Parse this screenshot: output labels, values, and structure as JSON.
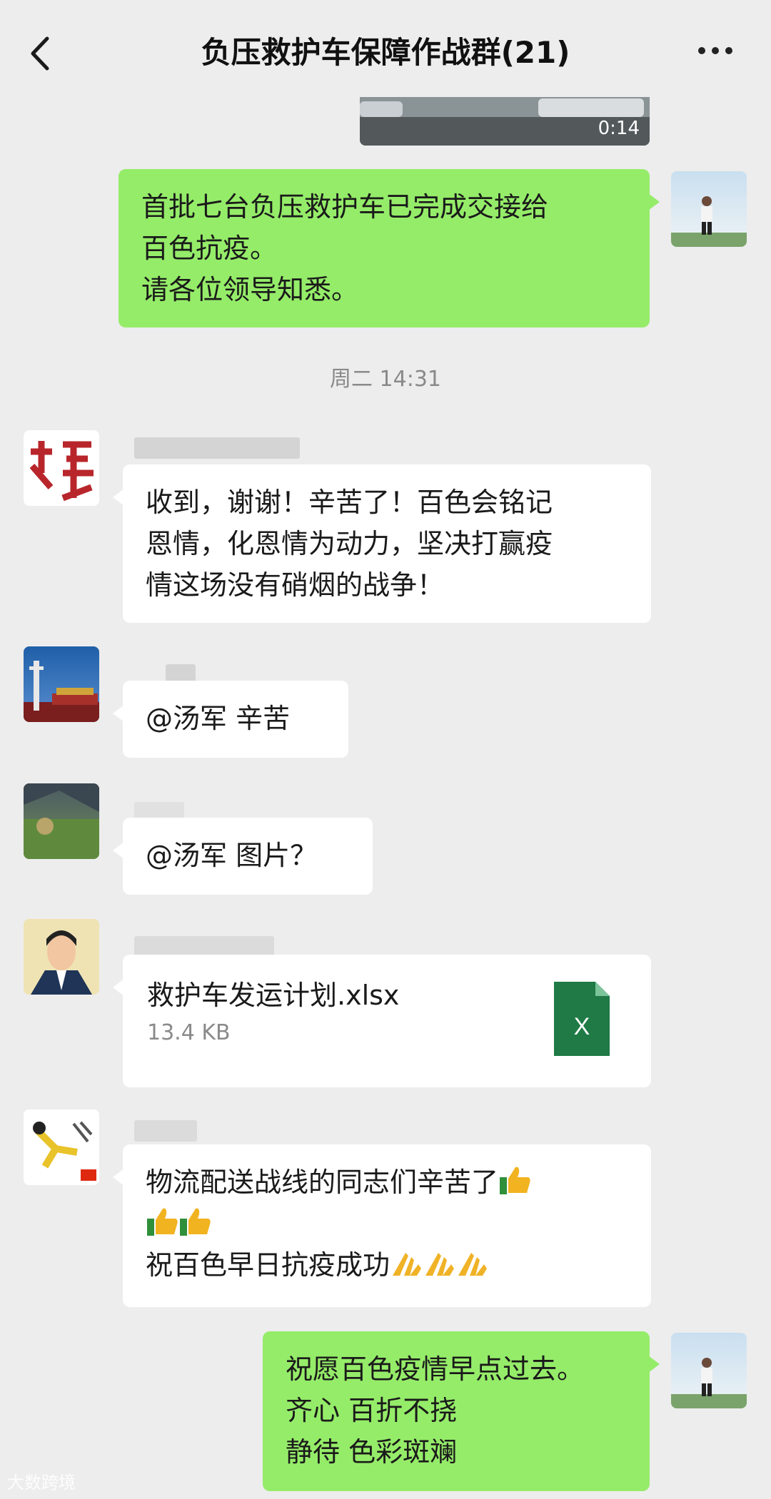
{
  "header": {
    "title": "负压救护车保障作战群(21)",
    "back_icon": "chevron-left-icon",
    "more_icon": "more-icon"
  },
  "video": {
    "duration": "0:14"
  },
  "messages": {
    "m1": {
      "text": "首批七台负压救护车已完成交接给\n百色抗疫。\n请各位领导知悉。"
    },
    "timestamp": "周二 14:31",
    "m2": {
      "text": "收到，谢谢！辛苦了！百色会铭记\n恩情，化恩情为动力，坚决打赢疫\n情这场没有硝烟的战争！"
    },
    "m3": {
      "text": "@汤军  辛苦"
    },
    "m4": {
      "text": "@汤军  图片？"
    },
    "m5": {
      "file_name": "救护车发运计划.xlsx",
      "file_size": "13.4 KB",
      "file_icon": "excel-file-icon",
      "file_icon_letter": "X"
    },
    "m6": {
      "line1": "物流配送战线的同志们辛苦了",
      "line3": "祝百色早日抗疫成功"
    },
    "m7": {
      "text": "祝愿百色疫情早点过去。\n齐心   百折不挠\n静待   色彩斑斓"
    }
  },
  "watermark": "大数跨境",
  "colors": {
    "background": "#ededed",
    "self_bubble": "#95ec69",
    "other_bubble": "#ffffff",
    "excel_green": "#1f7a45"
  }
}
